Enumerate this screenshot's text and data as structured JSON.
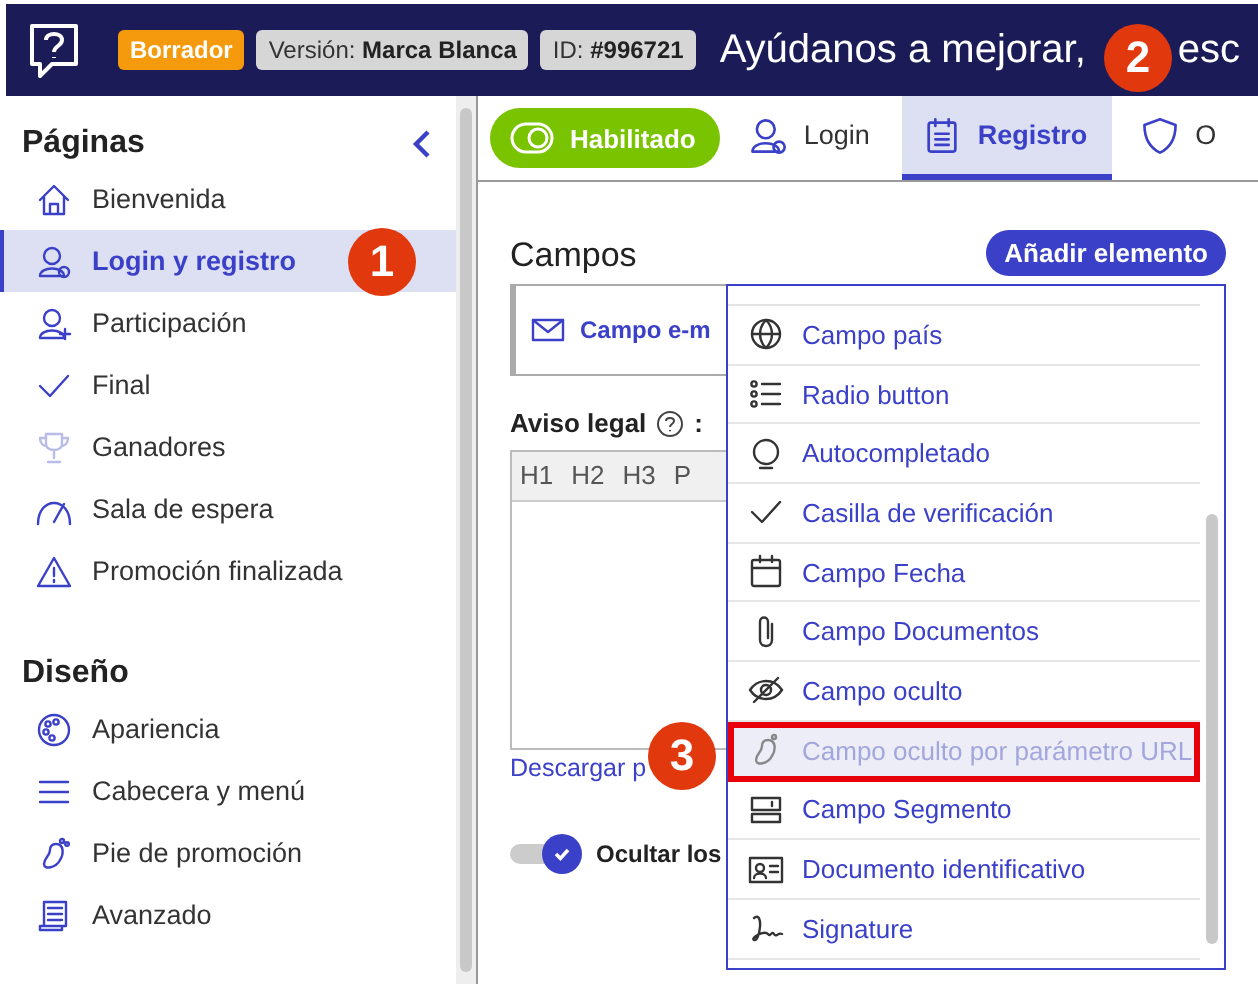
{
  "header": {
    "status": "Borrador",
    "version": {
      "label": "Versión:",
      "value": "Marca Blanca"
    },
    "id": {
      "label": "ID:",
      "value": "#996721"
    },
    "title": "Ayúdanos a mejorar,",
    "title_tail": "esc"
  },
  "sidebar": {
    "sections": [
      {
        "title": "Páginas",
        "items": [
          {
            "label": "Bienvenida",
            "selected": false
          },
          {
            "label": "Login y registro",
            "selected": true
          },
          {
            "label": "Participación",
            "selected": false
          },
          {
            "label": "Final",
            "selected": false
          },
          {
            "label": "Ganadores",
            "selected": false
          },
          {
            "label": "Sala de espera",
            "selected": false
          },
          {
            "label": "Promoción finalizada",
            "selected": false
          }
        ]
      },
      {
        "title": "Diseño",
        "items": [
          {
            "label": "Apariencia",
            "selected": false
          },
          {
            "label": "Cabecera y menú",
            "selected": false
          },
          {
            "label": "Pie de promoción",
            "selected": false
          },
          {
            "label": "Avanzado",
            "selected": false
          }
        ]
      }
    ]
  },
  "enabled_toggle": {
    "label": "Habilitado",
    "on": true
  },
  "tabs": [
    {
      "label": "Login",
      "selected": false
    },
    {
      "label": "Registro",
      "selected": true
    },
    {
      "label": "O",
      "selected": false
    }
  ],
  "fields": {
    "title": "Campos",
    "add_button": "Añadir elemento",
    "field_card": "Campo e-m"
  },
  "legal": {
    "label": "Aviso legal",
    "suffix": ":",
    "toolbar": [
      "H1",
      "H2",
      "H3",
      "P"
    ]
  },
  "download_link": "Descargar p",
  "hide_option": {
    "label": "Ocultar los",
    "on": true
  },
  "dropdown": {
    "items": [
      {
        "label": "Campo país",
        "highlighted": false
      },
      {
        "label": "Radio button",
        "highlighted": false
      },
      {
        "label": "Autocompletado",
        "highlighted": false
      },
      {
        "label": "Casilla de verificación",
        "highlighted": false
      },
      {
        "label": "Campo Fecha",
        "highlighted": false
      },
      {
        "label": "Campo Documentos",
        "highlighted": false
      },
      {
        "label": "Campo oculto",
        "highlighted": false
      },
      {
        "label": "Campo oculto por parámetro URL",
        "highlighted": true
      },
      {
        "label": "Campo Segmento",
        "highlighted": false
      },
      {
        "label": "Documento identificativo",
        "highlighted": false
      },
      {
        "label": "Signature",
        "highlighted": false
      }
    ]
  },
  "callouts": [
    "1",
    "2",
    "3"
  ]
}
